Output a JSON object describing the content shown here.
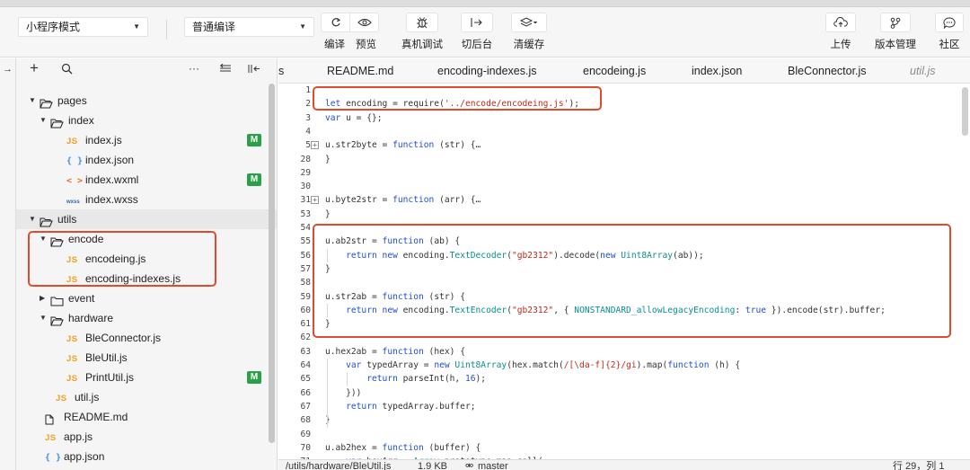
{
  "toolbar": {
    "mode_select": "小程序模式",
    "compile_select": "普通编译",
    "compile_label": "编译",
    "preview_label": "预览",
    "remote_debug_label": "真机调试",
    "background_label": "切后台",
    "clear_cache_label": "清缓存",
    "upload_label": "上传",
    "version_label": "版本管理",
    "community_label": "社区"
  },
  "tree": [
    {
      "name": "pages",
      "type": "folder",
      "open": true,
      "depth": 0
    },
    {
      "name": "index",
      "type": "folder",
      "open": true,
      "depth": 1
    },
    {
      "name": "index.js",
      "type": "js",
      "depth": 2,
      "badge": "M"
    },
    {
      "name": "index.json",
      "type": "json",
      "depth": 2
    },
    {
      "name": "index.wxml",
      "type": "wxml",
      "depth": 2,
      "badge": "M"
    },
    {
      "name": "index.wxss",
      "type": "wxss",
      "depth": 2
    },
    {
      "name": "utils",
      "type": "folder",
      "open": true,
      "depth": 0,
      "selected": true
    },
    {
      "name": "encode",
      "type": "folder",
      "open": true,
      "depth": 1
    },
    {
      "name": "encodeing.js",
      "type": "js",
      "depth": 2
    },
    {
      "name": "encoding-indexes.js",
      "type": "js",
      "depth": 2
    },
    {
      "name": "event",
      "type": "folder",
      "open": false,
      "depth": 1
    },
    {
      "name": "hardware",
      "type": "folder",
      "open": true,
      "depth": 1
    },
    {
      "name": "BleConnector.js",
      "type": "js",
      "depth": 2
    },
    {
      "name": "BleUtil.js",
      "type": "js",
      "depth": 2
    },
    {
      "name": "PrintUtil.js",
      "type": "js",
      "depth": 2,
      "badge": "M"
    },
    {
      "name": "util.js",
      "type": "js",
      "depth": 1
    },
    {
      "name": "README.md",
      "type": "file",
      "depth": 0
    },
    {
      "name": "app.js",
      "type": "js",
      "depth": 0
    },
    {
      "name": "app.json",
      "type": "json",
      "depth": 0
    }
  ],
  "icon_labels": {
    "js": "JS",
    "json": "{ }",
    "wxml": "< >",
    "wxss": "wxss",
    "badge": "M"
  },
  "tabs": [
    "s",
    "README.md",
    "encoding-indexes.js",
    "encodeing.js",
    "index.json",
    "BleConnector.js",
    "util.js"
  ],
  "code_lines": [
    {
      "n": "1",
      "text": ""
    },
    {
      "n": "2",
      "text": "let encoding = require('../encode/encodeing.js');"
    },
    {
      "n": "3",
      "text": "var u = {};"
    },
    {
      "n": "4",
      "text": ""
    },
    {
      "n": "5",
      "text": "u.str2byte = function (str) {…",
      "fold": true
    },
    {
      "n": "28",
      "text": "}"
    },
    {
      "n": "29",
      "text": ""
    },
    {
      "n": "30",
      "text": ""
    },
    {
      "n": "31",
      "text": "u.byte2str = function (arr) {…",
      "fold": true
    },
    {
      "n": "53",
      "text": "}"
    },
    {
      "n": "54",
      "text": ""
    },
    {
      "n": "55",
      "text": "u.ab2str = function (ab) {"
    },
    {
      "n": "56",
      "text": "    return new encoding.TextDecoder(\"gb2312\").decode(new Uint8Array(ab));"
    },
    {
      "n": "57",
      "text": "}"
    },
    {
      "n": "58",
      "text": ""
    },
    {
      "n": "59",
      "text": "u.str2ab = function (str) {"
    },
    {
      "n": "60",
      "text": "    return new encoding.TextEncoder(\"gb2312\", { NONSTANDARD_allowLegacyEncoding: true }).encode(str).buffer;"
    },
    {
      "n": "61",
      "text": "}"
    },
    {
      "n": "62",
      "text": ""
    },
    {
      "n": "63",
      "text": "u.hex2ab = function (hex) {"
    },
    {
      "n": "64",
      "text": "    var typedArray = new Uint8Array(hex.match(/[\\da-f]{2}/gi).map(function (h) {"
    },
    {
      "n": "65",
      "text": "        return parseInt(h, 16);"
    },
    {
      "n": "66",
      "text": "    }))"
    },
    {
      "n": "67",
      "text": "    return typedArray.buffer;"
    },
    {
      "n": "68",
      "text": "}"
    },
    {
      "n": "69",
      "text": ""
    },
    {
      "n": "70",
      "text": "u.ab2hex = function (buffer) {"
    },
    {
      "n": "71",
      "text": "    var hexArr = Array.prototype.map.call("
    }
  ],
  "status": {
    "path": "/utils/hardware/BleUtil.js",
    "size": "1.9 KB",
    "branch": "master",
    "position": "行 29，列 1"
  },
  "colors": {
    "highlight_box": "#e04b2b",
    "badge_modified": "#2aa148",
    "js_icon": "#f0a020"
  }
}
